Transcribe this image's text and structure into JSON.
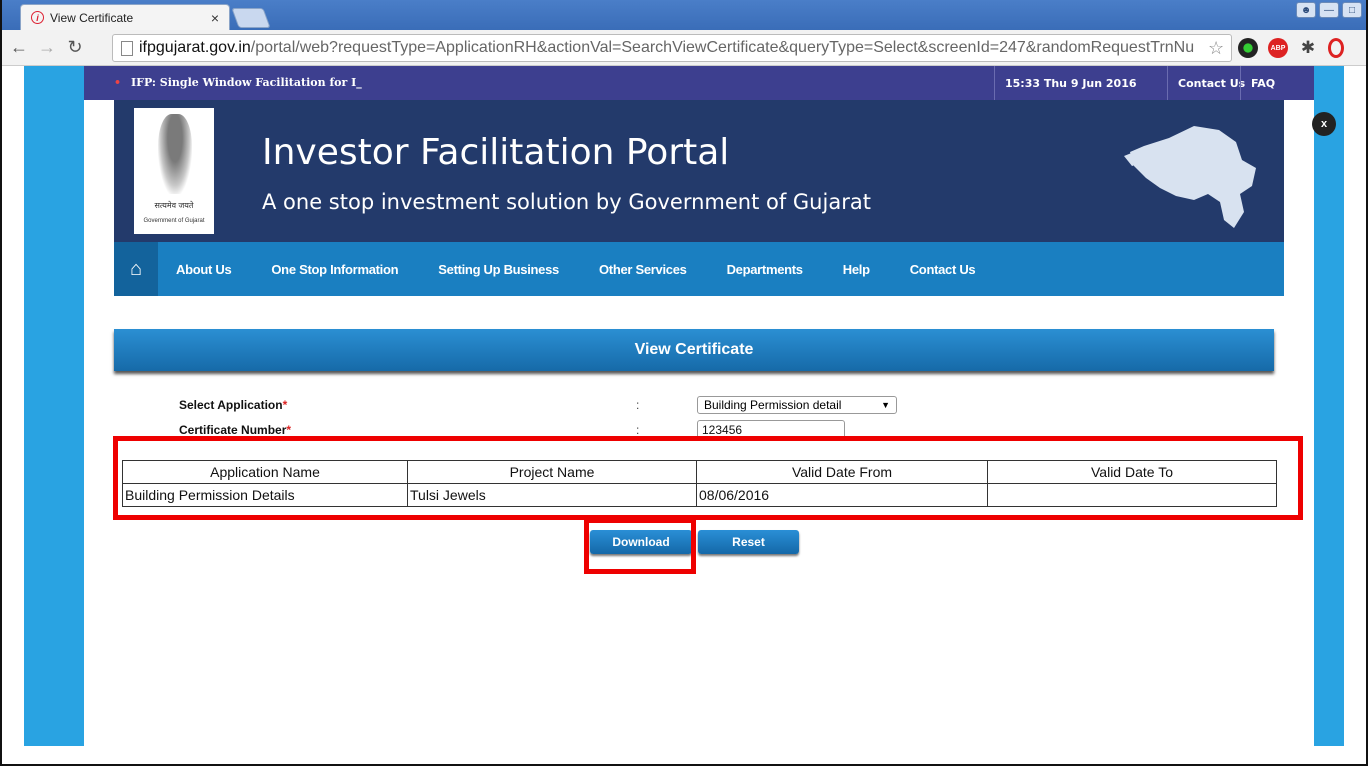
{
  "browser": {
    "tab_title": "View Certificate",
    "tab_close": "×",
    "url_host": "ifpgujarat.gov.in",
    "url_path": "/portal/web?requestType=ApplicationRH&actionVal=SearchViewCertificate&queryType=Select&screenId=247&randomRequestTrnNu"
  },
  "header": {
    "ticker": "IFP: Single Window Facilitation for I_",
    "datetime": "15:33  Thu  9 Jun 2016",
    "contact": "Contact Us",
    "faq": "FAQ"
  },
  "banner": {
    "title": "Investor Facilitation Portal",
    "subtitle": "A one stop investment solution by Government of Gujarat",
    "emblem_motto": "सत्यमेव जयते",
    "emblem_caption": "Government of Gujarat"
  },
  "nav": {
    "items": [
      "About Us",
      "One Stop Information",
      "Setting Up Business",
      "Other Services",
      "Departments",
      "Help",
      "Contact Us"
    ]
  },
  "form": {
    "heading": "View Certificate",
    "select_label": "Select Application",
    "select_value": "Building Permission detail",
    "cert_label": "Certificate Number",
    "cert_value": "123456",
    "required_mark": "*",
    "colon": ":"
  },
  "table": {
    "headers": [
      "Application Name",
      "Project Name",
      "Valid Date From",
      "Valid Date To"
    ],
    "rows": [
      [
        "Building Permission Details",
        "Tulsi Jewels",
        "08/06/2016",
        ""
      ]
    ]
  },
  "buttons": {
    "download": "Download",
    "reset": "Reset"
  },
  "overlay": {
    "close": "x"
  },
  "colors": {
    "highlight": "#ee0000",
    "nav": "#1a7fc1",
    "banner": "#233a6b",
    "page_bg": "#29a3e2"
  }
}
